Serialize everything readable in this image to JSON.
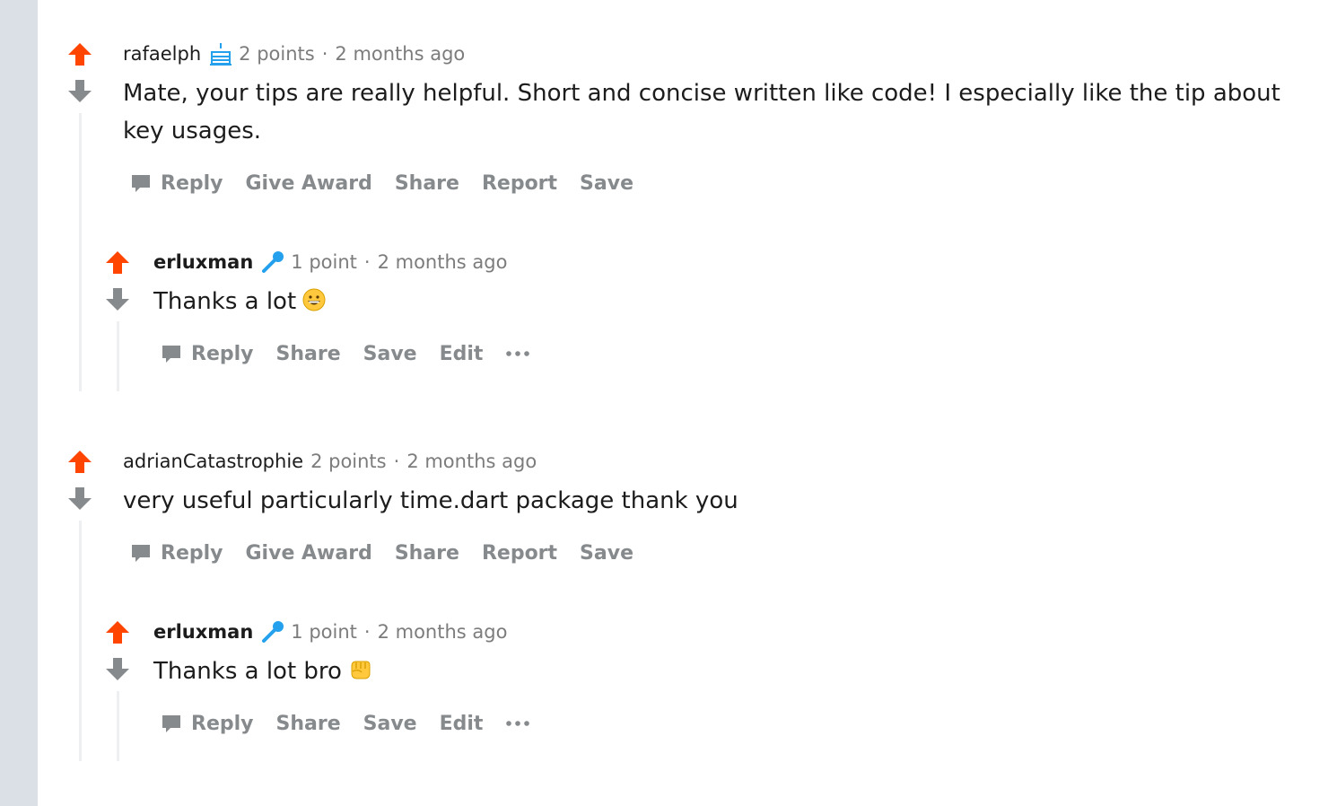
{
  "comments": [
    {
      "author": "rafaelph",
      "flair_icon": "cake-icon",
      "points": "2 points",
      "sep": "·",
      "time": "2 months ago",
      "body": "Mate, your tips are really helpful. Short and concise written like code! I especially like the tip about key usages.",
      "actions": {
        "reply": "Reply",
        "award": "Give Award",
        "share": "Share",
        "report": "Report",
        "save": "Save"
      },
      "reply": {
        "author": "erluxman",
        "flair_icon": "microphone-icon",
        "points": "1 point",
        "sep": "·",
        "time": "2 months ago",
        "body": "Thanks a lot",
        "emoji": "grinning-face-emoji",
        "actions": {
          "reply": "Reply",
          "share": "Share",
          "save": "Save",
          "edit": "Edit",
          "more": "more-options-icon"
        }
      }
    },
    {
      "author": "adrianCatastrophie",
      "points": "2 points",
      "sep": "·",
      "time": "2 months ago",
      "body": "very useful particularly time.dart package thank you",
      "actions": {
        "reply": "Reply",
        "award": "Give Award",
        "share": "Share",
        "report": "Report",
        "save": "Save"
      },
      "reply": {
        "author": "erluxman",
        "flair_icon": "microphone-icon",
        "points": "1 point",
        "sep": "·",
        "time": "2 months ago",
        "body": "Thanks a lot bro",
        "emoji": "fist-bump-emoji",
        "actions": {
          "reply": "Reply",
          "share": "Share",
          "save": "Save",
          "edit": "Edit",
          "more": "more-options-icon"
        }
      }
    }
  ],
  "colors": {
    "upvote": "#ff4500",
    "downvote": "#878a8c",
    "meta": "#7c7c7c",
    "action": "#878a8c",
    "rail": "#dae0e6",
    "thread_line": "#edeff1",
    "flair_blue": "#24a0ed"
  }
}
